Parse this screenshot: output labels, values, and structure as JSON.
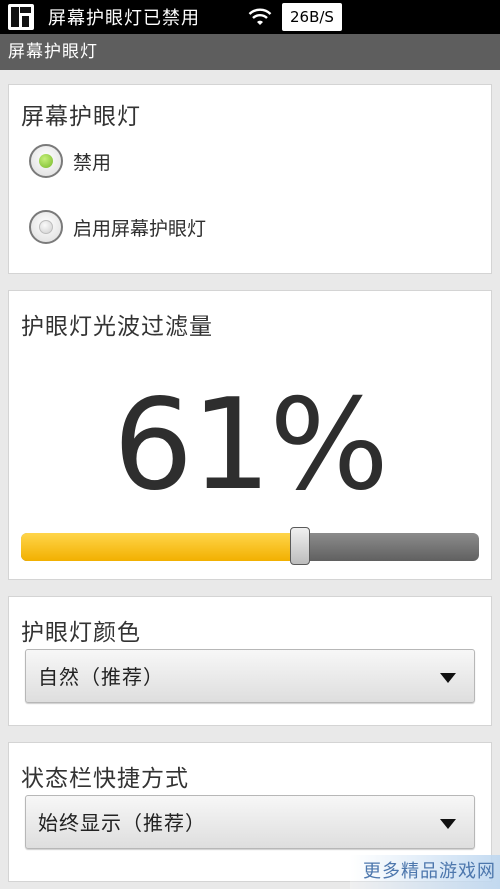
{
  "status_bar": {
    "title": "屏幕护眼灯已禁用",
    "network_speed": "26B/S",
    "icons": [
      "app-icon",
      "wifi-icon"
    ]
  },
  "app_bar": {
    "title": "屏幕护眼灯"
  },
  "toggle_section": {
    "title": "屏幕护眼灯",
    "options": [
      {
        "label": "禁用",
        "selected": true
      },
      {
        "label": "启用屏幕护眼灯",
        "selected": false
      }
    ]
  },
  "filter_section": {
    "title": "护眼灯光波过滤量",
    "value_text": "61%",
    "value": 61,
    "slider_fraction": 0.61
  },
  "color_section": {
    "title": "护眼灯颜色",
    "selected": "自然（推荐）"
  },
  "shortcut_section": {
    "title": "状态栏快捷方式",
    "selected": "始终显示（推荐）"
  },
  "watermark": "更多精品游戏网",
  "colors": {
    "accent_yellow": "#f5b800",
    "radio_green": "#8cc83a",
    "status_bar_bg": "#000000",
    "title_bar_bg": "#5e5e5e"
  }
}
